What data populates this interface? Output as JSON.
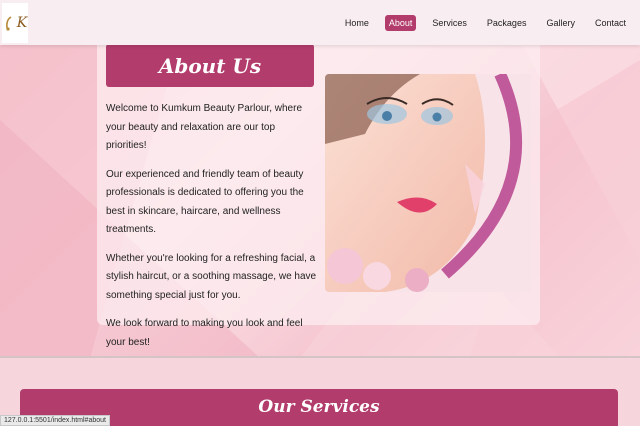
{
  "brand": {
    "logo_initial": "K"
  },
  "nav": {
    "items": [
      {
        "label": "Home",
        "active": false
      },
      {
        "label": "About",
        "active": true
      },
      {
        "label": "Services",
        "active": false
      },
      {
        "label": "Packages",
        "active": false
      },
      {
        "label": "Gallery",
        "active": false
      },
      {
        "label": "Contact",
        "active": false
      }
    ]
  },
  "about": {
    "title": "About Us",
    "paragraphs": [
      "Welcome to Kumkum Beauty Parlour, where your beauty and relaxation are our top priorities!",
      "Our experienced and friendly team of beauty professionals is dedicated to offering you the best in skincare, haircare, and wellness treatments.",
      "Whether you're looking for a refreshing facial, a stylish haircut, or a soothing massage, we have something special just for you.",
      "We look forward to making you look and feel your best!"
    ]
  },
  "services": {
    "title": "Our Services"
  },
  "status": {
    "url": "127.0.0.1:5501/index.html#about"
  },
  "colors": {
    "accent": "#b23c6b",
    "navbar": "#f8edf0",
    "background": "#f6d6dc"
  }
}
